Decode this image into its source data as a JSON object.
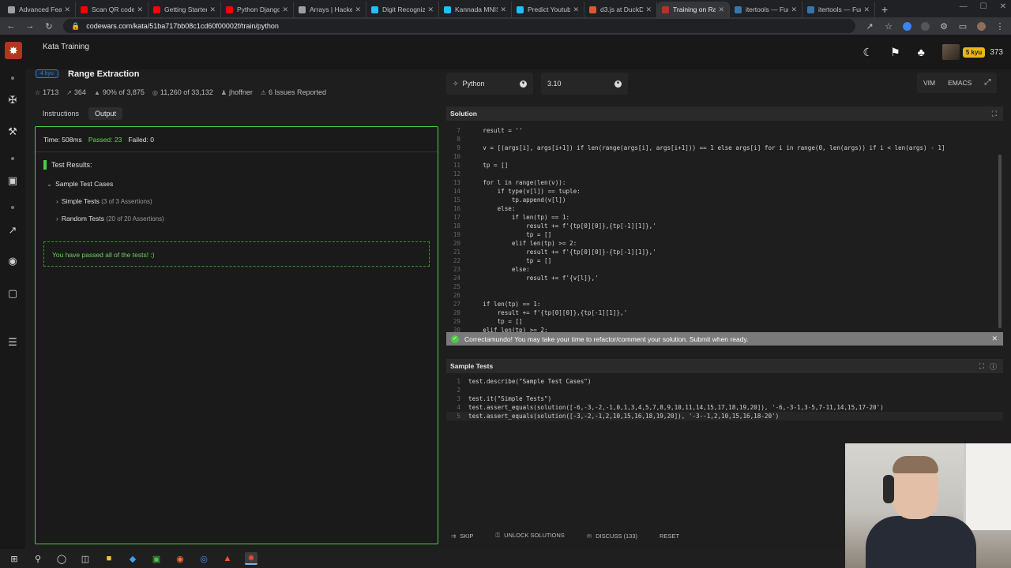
{
  "browser": {
    "tabs": [
      {
        "title": "Advanced Featu",
        "color": "#9aa0a6"
      },
      {
        "title": "Scan QR codes",
        "color": "#ff0000"
      },
      {
        "title": "Getting Started",
        "color": "#ff0000"
      },
      {
        "title": "Python Django",
        "color": "#ff0000"
      },
      {
        "title": "Arrays | Hacker",
        "color": "#9aa0a6"
      },
      {
        "title": "Digit Recogniz",
        "color": "#20beff"
      },
      {
        "title": "Kannada MNIS",
        "color": "#20beff"
      },
      {
        "title": "Predict Youtub",
        "color": "#20beff"
      },
      {
        "title": "d3.js at DuckD",
        "color": "#de5833"
      },
      {
        "title": "Training on Ra",
        "color": "#b1361e"
      },
      {
        "title": "itertools — Fun",
        "color": "#3776ab"
      },
      {
        "title": "itertools — Fun",
        "color": "#3776ab"
      }
    ],
    "new_tab": "+",
    "url": "codewars.com/kata/51ba717bb08c1cd60f00002f/train/python"
  },
  "header": {
    "section": "Kata Training",
    "rank": "5 kyu",
    "honor": "373"
  },
  "kata": {
    "kyu": "4 kyu",
    "title": "Range Extraction",
    "stats": {
      "stars": "1713",
      "votes": "364",
      "satisfaction": "90% of 3,875",
      "completed": "11,260 of 33,132",
      "author": "jhoffner",
      "issues": "6 Issues Reported"
    }
  },
  "left_tabs": {
    "instructions": "Instructions",
    "output": "Output"
  },
  "output": {
    "time": "Time: 508ms",
    "passed": "Passed: 23",
    "failed": "Failed: 0",
    "test_results": "Test Results:",
    "group": "Sample Test Cases",
    "tests": [
      {
        "name": "Simple Tests",
        "assertions": "(3 of 3 Assertions)"
      },
      {
        "name": "Random Tests",
        "assertions": "(20 of 20 Assertions)"
      }
    ],
    "passed_message": "You have passed all of the tests! :)"
  },
  "toolbar": {
    "language": "Python",
    "version": "3.10",
    "vim": "VIM",
    "emacs": "EMACS"
  },
  "solution": {
    "header": "Solution",
    "lines": [
      {
        "n": "7",
        "t": "    result = ''"
      },
      {
        "n": "8",
        "t": ""
      },
      {
        "n": "9",
        "t": "    v = [(args[i], args[i+1]) if len(range(args[i], args[i+1])) == 1 else args[i] for i in range(0, len(args)) if i < len(args) - 1]"
      },
      {
        "n": "10",
        "t": ""
      },
      {
        "n": "11",
        "t": "    tp = []"
      },
      {
        "n": "12",
        "t": ""
      },
      {
        "n": "13",
        "t": "    for l in range(len(v)):"
      },
      {
        "n": "14",
        "t": "        if type(v[l]) == tuple:"
      },
      {
        "n": "15",
        "t": "            tp.append(v[l])"
      },
      {
        "n": "16",
        "t": "        else:"
      },
      {
        "n": "17",
        "t": "            if len(tp) == 1:"
      },
      {
        "n": "18",
        "t": "                result += f'{tp[0][0]},{tp[-1][1]},'"
      },
      {
        "n": "19",
        "t": "                tp = []"
      },
      {
        "n": "20",
        "t": "            elif len(tp) >= 2:"
      },
      {
        "n": "21",
        "t": "                result += f'{tp[0][0]}-{tp[-1][1]},'"
      },
      {
        "n": "22",
        "t": "                tp = []"
      },
      {
        "n": "23",
        "t": "            else:"
      },
      {
        "n": "24",
        "t": "                result += f'{v[l]},'"
      },
      {
        "n": "25",
        "t": ""
      },
      {
        "n": "26",
        "t": ""
      },
      {
        "n": "27",
        "t": "    if len(tp) == 1:"
      },
      {
        "n": "28",
        "t": "        result += f'{tp[0][0]},{tp[-1][1]},'"
      },
      {
        "n": "29",
        "t": "        tp = []"
      },
      {
        "n": "30",
        "t": "    elif len(tp) >= 2:"
      }
    ]
  },
  "notice": "Correctamundo! You may take your time to refactor/comment your solution. Submit when ready.",
  "sample_tests": {
    "header": "Sample Tests",
    "lines": [
      {
        "n": "1",
        "t": "test.describe(\"Sample Test Cases\")"
      },
      {
        "n": "2",
        "t": ""
      },
      {
        "n": "3",
        "t": "test.it(\"Simple Tests\")"
      },
      {
        "n": "4",
        "t": "test.assert_equals(solution([-6,-3,-2,-1,0,1,3,4,5,7,8,9,10,11,14,15,17,18,19,20]), '-6,-3-1,3-5,7-11,14,15,17-20')"
      },
      {
        "n": "5",
        "t": "test.assert_equals(solution([-3,-2,-1,2,10,15,16,18,19,20]), '-3--1,2,10,15,16,18-20')"
      }
    ]
  },
  "actions": {
    "skip": "SKIP",
    "unlock": "UNLOCK SOLUTIONS",
    "discuss": "DISCUSS (133)",
    "reset": "RESET"
  }
}
